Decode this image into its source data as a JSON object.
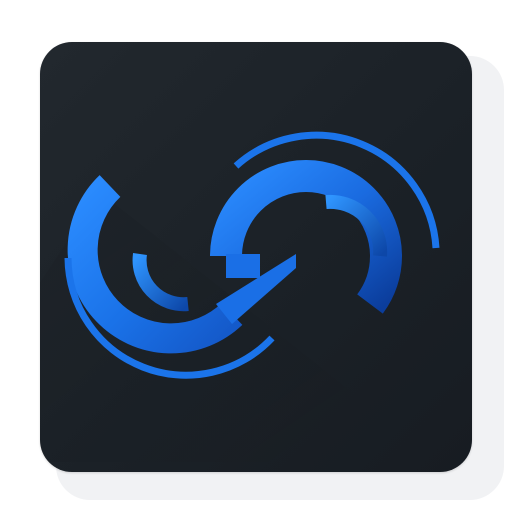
{
  "app_icon": {
    "icon_name": "blue-swirl-logo-icon",
    "colors": {
      "background": "#1c2228",
      "background_light": "#242a30",
      "accent_light": "#2b8cff",
      "accent": "#1565d8",
      "accent_dark": "#0b3d9c",
      "shadow": "#f1f2f4"
    }
  }
}
